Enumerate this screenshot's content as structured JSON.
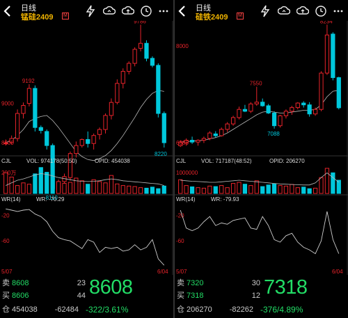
{
  "colors": {
    "up": "#e8232a",
    "down": "#00c8dc",
    "ma": "#bbbbbb",
    "quote_green": "#22dd66",
    "symbol": "#f0b400"
  },
  "panels": [
    {
      "period": "日线",
      "symbol": "锰硅2409",
      "badge": "M",
      "price_labels": {
        "level": "9000",
        "low_left": "8600",
        "high": "9786",
        "peak": "9192",
        "low": "8110",
        "last": "8220"
      },
      "y_range": [
        8560,
        9810
      ],
      "candles": [
        {
          "o": 8600,
          "h": 8640,
          "l": 8580,
          "c": 8605
        },
        {
          "o": 8610,
          "h": 8680,
          "l": 8590,
          "c": 8650
        },
        {
          "o": 8650,
          "h": 8940,
          "l": 8620,
          "c": 8900
        },
        {
          "o": 8900,
          "h": 9010,
          "l": 8850,
          "c": 8980
        },
        {
          "o": 9000,
          "h": 9192,
          "l": 8970,
          "c": 9150
        },
        {
          "o": 9150,
          "h": 9180,
          "l": 8720,
          "c": 8760
        },
        {
          "o": 8760,
          "h": 8780,
          "l": 8700,
          "c": 8730
        },
        {
          "o": 8720,
          "h": 8740,
          "l": 8540,
          "c": 8580
        },
        {
          "o": 8580,
          "h": 8600,
          "l": 8110,
          "c": 8150
        },
        {
          "o": 8120,
          "h": 8240,
          "l": 8110,
          "c": 8220
        },
        {
          "o": 8220,
          "h": 8300,
          "l": 8180,
          "c": 8270
        },
        {
          "o": 8260,
          "h": 8520,
          "l": 8230,
          "c": 8500
        },
        {
          "o": 8500,
          "h": 8620,
          "l": 8460,
          "c": 8580
        },
        {
          "o": 8580,
          "h": 8650,
          "l": 8560,
          "c": 8640
        },
        {
          "o": 8640,
          "h": 8720,
          "l": 8560,
          "c": 8600
        },
        {
          "o": 8600,
          "h": 8700,
          "l": 8540,
          "c": 8680
        },
        {
          "o": 8690,
          "h": 8760,
          "l": 8640,
          "c": 8740
        },
        {
          "o": 8740,
          "h": 8900,
          "l": 8700,
          "c": 8880
        },
        {
          "o": 8880,
          "h": 9050,
          "l": 8840,
          "c": 9010
        },
        {
          "o": 9010,
          "h": 9240,
          "l": 8990,
          "c": 9200
        },
        {
          "o": 9200,
          "h": 9350,
          "l": 9150,
          "c": 9320
        },
        {
          "o": 9320,
          "h": 9420,
          "l": 9290,
          "c": 9400
        },
        {
          "o": 9400,
          "h": 9560,
          "l": 9370,
          "c": 9540
        },
        {
          "o": 9550,
          "h": 9786,
          "l": 9520,
          "c": 9600
        },
        {
          "o": 9600,
          "h": 9630,
          "l": 9420,
          "c": 9450
        },
        {
          "o": 9450,
          "h": 9470,
          "l": 9360,
          "c": 9380
        },
        {
          "o": 9380,
          "h": 9400,
          "l": 8860,
          "c": 8900
        },
        {
          "o": 8900,
          "h": 8920,
          "l": 8560,
          "c": 8608
        }
      ],
      "ma_daily": [
        8610,
        8630,
        8680,
        8740,
        8820,
        8850,
        8870,
        8880,
        8830,
        8760,
        8680,
        8600,
        8520,
        8470,
        8440,
        8430,
        8450,
        8480,
        8530,
        8600,
        8680,
        8770,
        8860,
        8960,
        9040,
        9100,
        9130,
        9120
      ],
      "vol_title": "CJL",
      "vol_text": "VOL: 974178(50:50)",
      "opi_text": "OPID: 454038",
      "vol_axis_label": "200万",
      "volumes": [
        0.78,
        0.62,
        0.3,
        0.4,
        0.35,
        0.74,
        0.98,
        0.8,
        0.6,
        0.45,
        0.38,
        0.42,
        0.58,
        0.48,
        0.35,
        0.52,
        0.45,
        0.4,
        0.68,
        0.36,
        0.3,
        0.28,
        0.26,
        0.22,
        0.2,
        0.24,
        0.18,
        0.28
      ],
      "opi_line": [
        0.3,
        0.4,
        0.5,
        0.55,
        0.62,
        0.7,
        0.75,
        0.72,
        0.66,
        0.6,
        0.56,
        0.52,
        0.48,
        0.46,
        0.45,
        0.46,
        0.48,
        0.52,
        0.55,
        0.52,
        0.48,
        0.46,
        0.44,
        0.42,
        0.4,
        0.38,
        0.36,
        0.3
      ],
      "wr_title": "WR(14)",
      "wr_value_text": "WR: -70.29",
      "wr_levels": [
        "-20",
        "-60"
      ],
      "wr": [
        -10,
        -12,
        -14,
        -12,
        -11,
        -18,
        -22,
        -30,
        -45,
        -55,
        -58,
        -60,
        -66,
        -72,
        -58,
        -62,
        -78,
        -70,
        -72,
        -70,
        -76,
        -74,
        -66,
        -74,
        -70,
        -58,
        -88,
        -98
      ],
      "date_start": "5/07",
      "date_end": "6/04",
      "quote": {
        "sell_label": "卖",
        "sell_price": "8608",
        "sell_vol": "23",
        "buy_label": "买",
        "buy_price": "8606",
        "buy_vol": "44",
        "last": "8608",
        "oi_label": "仓",
        "oi": "454038",
        "oi_change": "-62484",
        "change": "-322/3.61%"
      }
    },
    {
      "period": "日线",
      "symbol": "硅铁2409",
      "badge": "M",
      "price_labels": {
        "level": "8000",
        "high": "8234",
        "peak": "7550",
        "low": "7088",
        "low_left": "6886"
      },
      "y_range": [
        6880,
        8260
      ],
      "candles": [
        {
          "o": 6900,
          "h": 6960,
          "l": 6886,
          "c": 6940
        },
        {
          "o": 6930,
          "h": 6980,
          "l": 6900,
          "c": 6960
        },
        {
          "o": 6960,
          "h": 7000,
          "l": 6920,
          "c": 6940
        },
        {
          "o": 6940,
          "h": 6970,
          "l": 6900,
          "c": 6960
        },
        {
          "o": 6960,
          "h": 7000,
          "l": 6930,
          "c": 6980
        },
        {
          "o": 6980,
          "h": 7060,
          "l": 6960,
          "c": 7040
        },
        {
          "o": 7030,
          "h": 7060,
          "l": 6990,
          "c": 7010
        },
        {
          "o": 7010,
          "h": 7100,
          "l": 7000,
          "c": 7080
        },
        {
          "o": 7080,
          "h": 7160,
          "l": 7050,
          "c": 7140
        },
        {
          "o": 7140,
          "h": 7230,
          "l": 7120,
          "c": 7210
        },
        {
          "o": 7210,
          "h": 7330,
          "l": 7190,
          "c": 7300
        },
        {
          "o": 7300,
          "h": 7350,
          "l": 7270,
          "c": 7280
        },
        {
          "o": 7280,
          "h": 7380,
          "l": 7260,
          "c": 7360
        },
        {
          "o": 7360,
          "h": 7550,
          "l": 7340,
          "c": 7380
        },
        {
          "o": 7380,
          "h": 7420,
          "l": 7330,
          "c": 7340
        },
        {
          "o": 7340,
          "h": 7360,
          "l": 7250,
          "c": 7260
        },
        {
          "o": 7260,
          "h": 7280,
          "l": 7088,
          "c": 7120
        },
        {
          "o": 7120,
          "h": 7240,
          "l": 7100,
          "c": 7230
        },
        {
          "o": 7230,
          "h": 7300,
          "l": 7200,
          "c": 7280
        },
        {
          "o": 7280,
          "h": 7340,
          "l": 7240,
          "c": 7320
        },
        {
          "o": 7320,
          "h": 7380,
          "l": 7300,
          "c": 7370
        },
        {
          "o": 7370,
          "h": 7390,
          "l": 7320,
          "c": 7350
        },
        {
          "o": 7350,
          "h": 7380,
          "l": 7220,
          "c": 7250
        },
        {
          "o": 7250,
          "h": 7320,
          "l": 7230,
          "c": 7300
        },
        {
          "o": 7300,
          "h": 7720,
          "l": 7280,
          "c": 7700
        },
        {
          "o": 7700,
          "h": 8234,
          "l": 7680,
          "c": 8120
        },
        {
          "o": 8130,
          "h": 8150,
          "l": 7620,
          "c": 7650
        },
        {
          "o": 7650,
          "h": 7660,
          "l": 7300,
          "c": 7318
        }
      ],
      "ma_daily": [
        6940,
        6945,
        6950,
        6955,
        6960,
        6975,
        6990,
        7010,
        7040,
        7080,
        7120,
        7160,
        7200,
        7240,
        7270,
        7280,
        7270,
        7260,
        7260,
        7270,
        7280,
        7290,
        7290,
        7300,
        7350,
        7440,
        7500,
        7510
      ],
      "vol_title": "CJL",
      "vol_text": "VOL: 717187(48:52)",
      "opi_text": "OPID: 206270",
      "vol_axis_label": "1000000",
      "volumes": [
        0.52,
        0.3,
        0.25,
        0.22,
        0.2,
        0.28,
        0.26,
        0.3,
        0.22,
        0.38,
        0.42,
        0.35,
        0.3,
        0.48,
        0.26,
        0.32,
        0.36,
        0.3,
        0.28,
        0.34,
        0.22,
        0.24,
        0.18,
        0.2,
        0.6,
        0.95,
        0.78,
        0.5
      ],
      "opi_line": [
        0.5,
        0.48,
        0.46,
        0.45,
        0.44,
        0.42,
        0.42,
        0.44,
        0.46,
        0.48,
        0.5,
        0.48,
        0.46,
        0.44,
        0.42,
        0.4,
        0.38,
        0.36,
        0.35,
        0.34,
        0.33,
        0.32,
        0.32,
        0.4,
        0.6,
        0.78,
        0.6,
        0.42
      ],
      "wr_title": "WR(14)",
      "wr_value_text": "WR: -79.93",
      "wr_levels": [
        "-20",
        "-60"
      ],
      "wr": [
        -12,
        -40,
        -44,
        -40,
        -30,
        -22,
        -36,
        -32,
        -34,
        -28,
        -26,
        -24,
        -40,
        -42,
        -22,
        -36,
        -58,
        -62,
        -52,
        -48,
        -62,
        -70,
        -74,
        -80,
        -60,
        -14,
        -58,
        -80
      ],
      "date_start": "5/07",
      "date_end": "6/04",
      "quote": {
        "sell_label": "卖",
        "sell_price": "7320",
        "sell_vol": "30",
        "buy_label": "买",
        "buy_price": "7318",
        "buy_vol": "12",
        "last": "7318",
        "oi_label": "仓",
        "oi": "206270",
        "oi_change": "-82262",
        "change": "-376/4.89%"
      }
    }
  ],
  "icons": [
    "back-arrow-icon",
    "lightning-icon",
    "cloud-sync-icon",
    "cloud-upload-icon",
    "clock-icon",
    "more-icon"
  ]
}
